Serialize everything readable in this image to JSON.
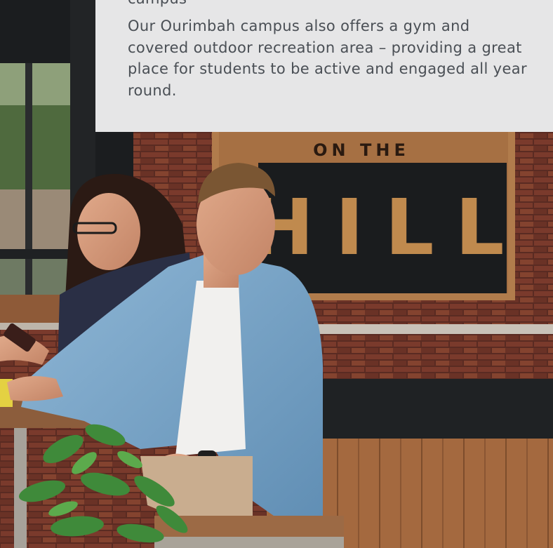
{
  "panel": {
    "cut_text": "campus",
    "paragraph": "Our Ourimbah campus also offers a gym and covered outdoor recreation area – providing a great place for students to be active and engaged all year round."
  },
  "photo": {
    "sign_line1": "ON THE",
    "sign_line2": "HILL"
  },
  "colors": {
    "panel_bg": "#e6e6e7",
    "text": "#4a4f55",
    "brick": "#6b3528",
    "deck": "#a06a45",
    "shirt": "#7aa8cc"
  }
}
